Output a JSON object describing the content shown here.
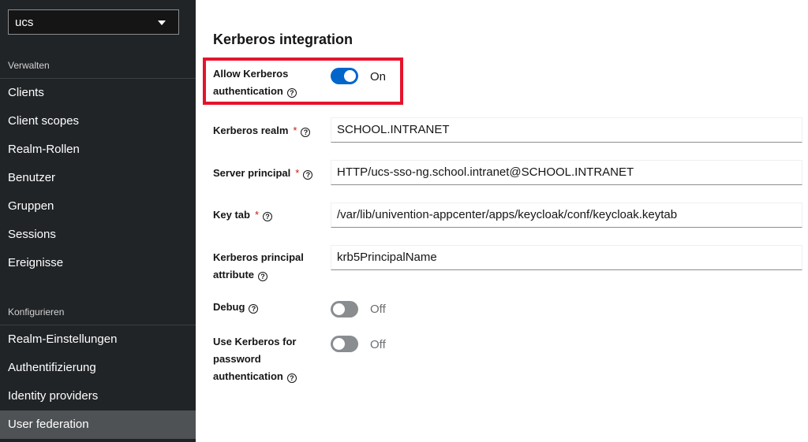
{
  "sidebar": {
    "realm_selector": {
      "value": "ucs"
    },
    "sections": [
      {
        "heading": "Verwalten",
        "items": [
          {
            "label": "Clients"
          },
          {
            "label": "Client scopes"
          },
          {
            "label": "Realm-Rollen"
          },
          {
            "label": "Benutzer"
          },
          {
            "label": "Gruppen"
          },
          {
            "label": "Sessions"
          },
          {
            "label": "Ereignisse"
          }
        ]
      },
      {
        "heading": "Konfigurieren",
        "items": [
          {
            "label": "Realm-Einstellungen"
          },
          {
            "label": "Authentifizierung"
          },
          {
            "label": "Identity providers"
          },
          {
            "label": "User federation",
            "active": true
          }
        ]
      }
    ]
  },
  "main": {
    "section_title": "Kerberos integration",
    "fields": {
      "allow_kerberos": {
        "label_line1": "Allow Kerberos",
        "label_line2": "authentication",
        "state": "On"
      },
      "kerberos_realm": {
        "label": "Kerberos realm",
        "required": "*",
        "value": "SCHOOL.INTRANET"
      },
      "server_principal": {
        "label": "Server principal",
        "required": "*",
        "value": "HTTP/ucs-sso-ng.school.intranet@SCHOOL.INTRANET"
      },
      "key_tab": {
        "label": "Key tab",
        "required": "*",
        "value": "/var/lib/univention-appcenter/apps/keycloak/conf/keycloak.keytab"
      },
      "principal_attribute": {
        "label_line1": "Kerberos principal",
        "label_line2": "attribute",
        "value": "krb5PrincipalName"
      },
      "debug": {
        "label": "Debug",
        "state": "Off"
      },
      "use_kerberos_password": {
        "label_line1": "Use Kerberos for",
        "label_line2": "password",
        "label_line3": "authentication",
        "state": "Off"
      }
    }
  },
  "colors": {
    "sidebar_bg": "#212427",
    "active_item_bg": "#4f5255",
    "toggle_on": "#0066cc",
    "toggle_off": "#8a8d90",
    "highlight": "#e4142c",
    "required": "#c9190b"
  },
  "icons": {
    "help": "help-circle-icon",
    "dropdown": "caret-down-icon"
  }
}
